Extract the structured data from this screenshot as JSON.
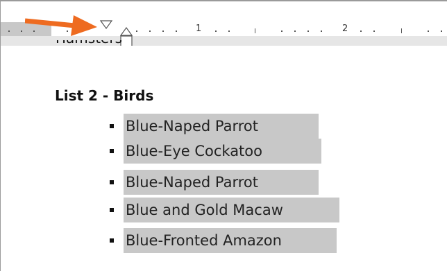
{
  "ruler": {
    "numbers": [
      "1",
      "2"
    ]
  },
  "document": {
    "cut_line_text": "Hamsters",
    "list_title": "List 2 - Birds",
    "items": [
      "Blue-Naped Parrot",
      "Blue-Eye Cockatoo",
      "Blue-Naped Parrot",
      "Blue and Gold Macaw",
      "Blue-Fronted Amazon"
    ]
  },
  "colors": {
    "highlight": "#c8c8c8",
    "arrow": "#ee6b20",
    "ruler_bg": "#e6e6e6"
  }
}
